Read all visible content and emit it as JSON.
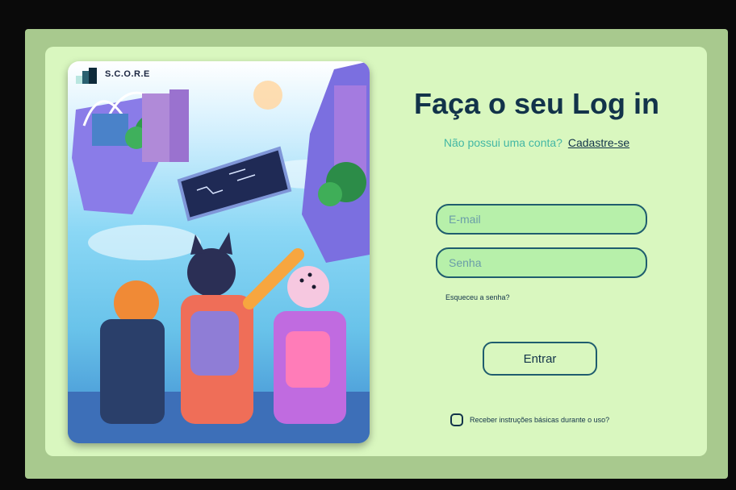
{
  "logo": {
    "text": "S.C.O.R.E"
  },
  "login": {
    "title": "Faça o seu Log in",
    "no_account_text": "Não possui uma conta?",
    "signup_link": "Cadastre-se",
    "email_placeholder": "E-mail",
    "password_placeholder": "Senha",
    "forgot_password": "Esqueceu a senha?",
    "submit_label": "Entrar",
    "instructions_checkbox_label": "Receber instruções básicas durante o uso?"
  },
  "colors": {
    "page_background": "#0a0a0a",
    "outer_panel": "#a8c98e",
    "card_background": "#d9f7bf",
    "title": "#12334a",
    "accent_teal": "#43b7a4",
    "field_border": "#1f5d6e",
    "field_fill": "#b7f0aa"
  },
  "icons": {
    "logo_mark": "logo-mark-icon",
    "checkbox": "checkbox-icon"
  }
}
